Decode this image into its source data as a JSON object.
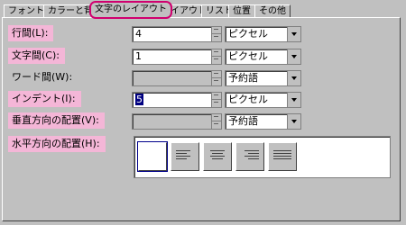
{
  "tabs": [
    {
      "label": "フォント"
    },
    {
      "label": "カラーと背景"
    },
    {
      "label": "文字のレイアウト"
    },
    {
      "label": "レイアウト"
    },
    {
      "label": "リスト"
    },
    {
      "label": "位置"
    },
    {
      "label": "その他"
    }
  ],
  "active_tab_index": 2,
  "fields": {
    "line_spacing": {
      "label": "行間(L):",
      "value": "4",
      "unit": "ピクセル"
    },
    "letter_spacing": {
      "label": "文字間(C):",
      "value": "1",
      "unit": "ピクセル"
    },
    "word_spacing": {
      "label": "ワード間(W):",
      "value": "",
      "unit": "予約語"
    },
    "indent": {
      "label": "インデント(I):",
      "value": "5",
      "unit": "ピクセル"
    },
    "vertical_align": {
      "label": "垂直方向の配置(V):",
      "value": "",
      "unit": "予約語"
    },
    "horizontal_align": {
      "label": "水平方向の配置(H):"
    }
  },
  "horizontal_align_options": [
    {
      "name": "align-none"
    },
    {
      "name": "align-left"
    },
    {
      "name": "align-center"
    },
    {
      "name": "align-right"
    },
    {
      "name": "align-justify"
    }
  ],
  "colors": {
    "highlight": "#f4b6d7",
    "tab_circle": "#d0006f",
    "selection": "#000080"
  }
}
